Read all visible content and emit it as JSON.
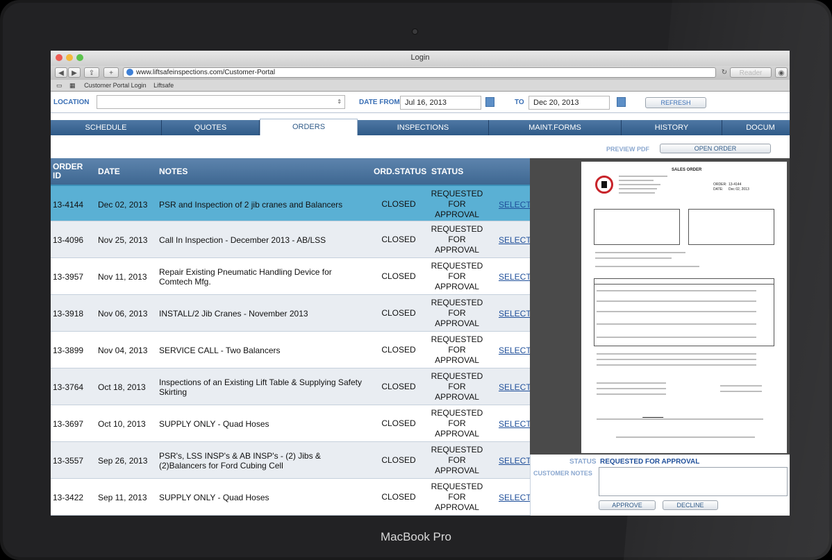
{
  "device": {
    "brand": "MacBook Pro"
  },
  "browser": {
    "window_title": "Login",
    "url": "www.liftsafeinspections.com/Customer-Portal",
    "reader_label": "Reader",
    "bookmarks": [
      "Customer Portal Login",
      "Liftsafe"
    ]
  },
  "filters": {
    "location_label": "LOCATION",
    "location_value": "",
    "date_from_label": "DATE FROM",
    "date_from_value": "Jul 16, 2013",
    "to_label": "TO",
    "to_value": "Dec 20, 2013",
    "refresh_label": "REFRESH"
  },
  "tabs": [
    {
      "label": "SCHEDULE"
    },
    {
      "label": "QUOTES"
    },
    {
      "label": "ORDERS"
    },
    {
      "label": "INSPECTIONS"
    },
    {
      "label": "MAINT.FORMS"
    },
    {
      "label": "HISTORY"
    },
    {
      "label": "DOCUM"
    }
  ],
  "actions": {
    "preview_pdf": "PREVIEW PDF",
    "open_order": "OPEN ORDER"
  },
  "table": {
    "headers": {
      "order_id": "ORDER ID",
      "date": "DATE",
      "notes": "NOTES",
      "ord_status": "ORD.STATUS",
      "status": "STATUS"
    },
    "rows": [
      {
        "id": "13-4144",
        "date": "Dec 02, 2013",
        "notes": "PSR and Inspection of 2 jib cranes and Balancers",
        "ord_status": "CLOSED",
        "status": "REQUESTED FOR APPROVAL",
        "link": "SELECT"
      },
      {
        "id": "13-4096",
        "date": "Nov 25, 2013",
        "notes": "Call In Inspection - December 2013 - AB/LSS",
        "ord_status": "CLOSED",
        "status": "REQUESTED FOR APPROVAL",
        "link": "SELECT"
      },
      {
        "id": "13-3957",
        "date": "Nov 11, 2013",
        "notes": "Repair Existing Pneumatic Handling Device for Comtech Mfg.",
        "ord_status": "CLOSED",
        "status": "REQUESTED FOR APPROVAL",
        "link": "SELECT"
      },
      {
        "id": "13-3918",
        "date": "Nov 06, 2013",
        "notes": "INSTALL/2 Jib Cranes - November 2013",
        "ord_status": "CLOSED",
        "status": "REQUESTED FOR APPROVAL",
        "link": "SELECT"
      },
      {
        "id": "13-3899",
        "date": "Nov 04, 2013",
        "notes": "SERVICE CALL - Two Balancers",
        "ord_status": "CLOSED",
        "status": "REQUESTED FOR APPROVAL",
        "link": "SELECT"
      },
      {
        "id": "13-3764",
        "date": "Oct 18, 2013",
        "notes": "Inspections of an Existing Lift Table & Supplying Safety Skirting",
        "ord_status": "CLOSED",
        "status": "REQUESTED FOR APPROVAL",
        "link": "SELECT"
      },
      {
        "id": "13-3697",
        "date": "Oct 10, 2013",
        "notes": "SUPPLY ONLY - Quad Hoses",
        "ord_status": "CLOSED",
        "status": "REQUESTED FOR APPROVAL",
        "link": "SELECT"
      },
      {
        "id": "13-3557",
        "date": "Sep 26, 2013",
        "notes": "PSR's, LSS INSP's & AB INSP's - (2) Jibs & (2)Balancers for Ford Cubing Cell",
        "ord_status": "CLOSED",
        "status": "REQUESTED FOR APPROVAL",
        "link": "SELECT"
      },
      {
        "id": "13-3422",
        "date": "Sep 11, 2013",
        "notes": "SUPPLY ONLY - Quad Hoses",
        "ord_status": "CLOSED",
        "status": "REQUESTED FOR APPROVAL",
        "link": "SELECT"
      }
    ]
  },
  "preview_doc": {
    "title": "SALES ORDER",
    "order_label": "ORDER:",
    "order_value": "13-4144",
    "date_label": "DATE:",
    "date_value": "Dec 02, 2013"
  },
  "approval": {
    "status_label": "STATUS",
    "status_value": "REQUESTED FOR APPROVAL",
    "notes_label": "CUSTOMER NOTES",
    "notes_value": "",
    "approve_label": "APPROVE",
    "decline_label": "DECLINE"
  },
  "colors": {
    "accent": "#3a6fb5",
    "selected_row": "#5ab0d4",
    "tab_bar": "#3e6791",
    "bezel": "#1a1a1b"
  }
}
